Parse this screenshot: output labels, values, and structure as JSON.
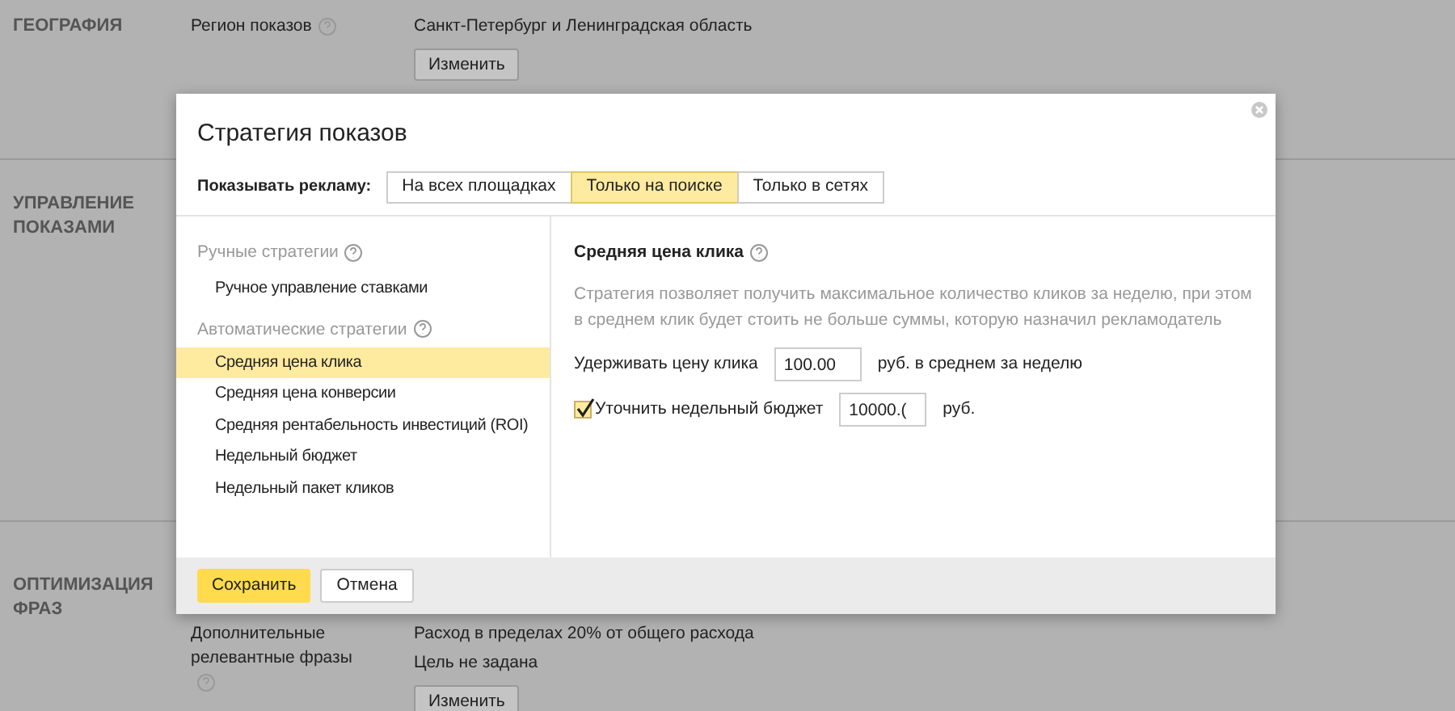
{
  "page": {
    "sections": [
      {
        "title": "ГЕОГРАФИЯ",
        "rows": [
          {
            "label": "Регион показов",
            "help": true,
            "values": [
              "Санкт-Петербург и Ленинградская область"
            ],
            "button": "Изменить"
          }
        ]
      },
      {
        "title": "УПРАВЛЕНИЕ ПОКАЗАМИ"
      },
      {
        "title": "ОПТИМИЗАЦИЯ ФРАЗ",
        "rows": [
          {
            "label": "Дополнительные релевантные фразы",
            "help": true,
            "values": [
              "Расход в пределах 20% от общего расхода",
              "Цель не задана"
            ],
            "button": "Изменить"
          }
        ]
      }
    ]
  },
  "dialog": {
    "title": "Стратегия показов",
    "show_label": "Показывать рекламу:",
    "tabs": [
      {
        "label": "На всех площадках",
        "selected": false
      },
      {
        "label": "Только на поиске",
        "selected": true
      },
      {
        "label": "Только в сетях",
        "selected": false
      }
    ],
    "groups": [
      {
        "title": "Ручные стратегии",
        "items": [
          {
            "label": "Ручное управление ставками",
            "selected": false
          }
        ]
      },
      {
        "title": "Автоматические стратегии",
        "items": [
          {
            "label": "Средняя цена клика",
            "selected": true
          },
          {
            "label": "Средняя цена конверсии",
            "selected": false
          },
          {
            "label": "Средняя рентабельность инвестиций (ROI)",
            "selected": false
          },
          {
            "label": "Недельный бюджет",
            "selected": false
          },
          {
            "label": "Недельный пакет кликов",
            "selected": false
          }
        ]
      }
    ],
    "detail": {
      "title": "Средняя цена клика",
      "description": "Стратегия позволяет получить максимальное количество кликов за неделю, при этом в среднем клик будет стоить не больше суммы, которую назначил рекламодатель",
      "fields": [
        {
          "kind": "plain",
          "label": "Удерживать цену клика",
          "value": "100.00",
          "suffix": "руб. в среднем за неделю"
        },
        {
          "kind": "checkbox",
          "checked": true,
          "label": "Уточнить недельный бюджет",
          "value": "10000.(",
          "suffix": "руб."
        }
      ]
    },
    "buttons": [
      {
        "label": "Сохранить",
        "primary": true
      },
      {
        "label": "Отмена",
        "primary": false
      }
    ]
  }
}
